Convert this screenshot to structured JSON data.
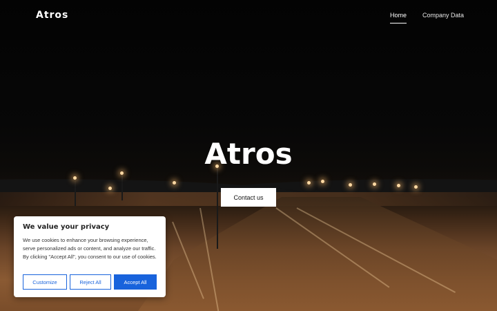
{
  "nav": {
    "logo": "Atros",
    "links": [
      {
        "label": "Home",
        "active": true
      },
      {
        "label": "Company Data",
        "active": false
      }
    ]
  },
  "hero": {
    "title": "Atros",
    "cta_label": "Contact us"
  },
  "cookie_banner": {
    "title": "We value your privacy",
    "text": "We use cookies to enhance your browsing experience, serve personalized ads or content, and analyze our traffic. By clicking \"Accept All\", you consent to our use of cookies.",
    "customize_label": "Customize",
    "reject_label": "Reject All",
    "accept_label": "Accept All"
  },
  "colors": {
    "accent": "#1863dc",
    "banner_bg": "#ffffff",
    "hero_text": "#ffffff"
  }
}
